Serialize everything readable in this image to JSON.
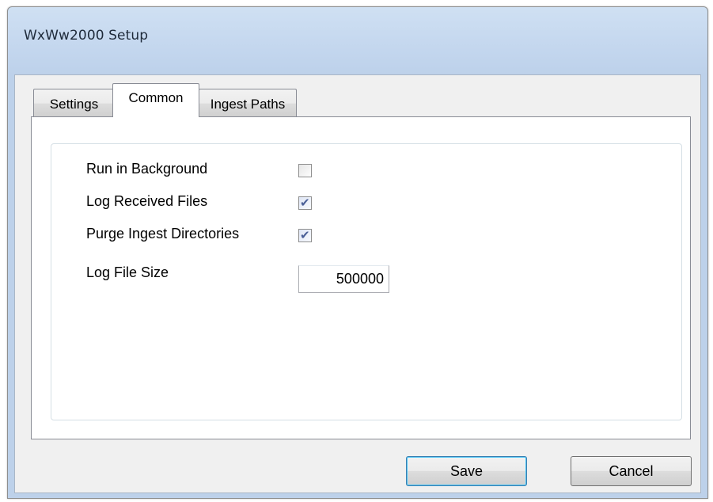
{
  "window": {
    "title": "WxWw2000 Setup"
  },
  "tabs": [
    {
      "label": "Settings",
      "selected": false
    },
    {
      "label": "Common",
      "selected": true
    },
    {
      "label": "Ingest Paths",
      "selected": false
    }
  ],
  "common": {
    "run_in_background": {
      "label": "Run in Background",
      "checked": false
    },
    "log_received_files": {
      "label": "Log Received Files",
      "checked": true
    },
    "purge_ingest_directories": {
      "label": "Purge Ingest Directories",
      "checked": true
    },
    "log_file_size": {
      "label": "Log File Size",
      "value": "500000"
    }
  },
  "buttons": {
    "save_label": "Save",
    "cancel_label": "Cancel"
  },
  "colors": {
    "title_bar": "#c3d6ee",
    "client_bg": "#f0f0f0",
    "check_mark": "#4a5f97",
    "default_button_border": "#3c7fb1"
  }
}
